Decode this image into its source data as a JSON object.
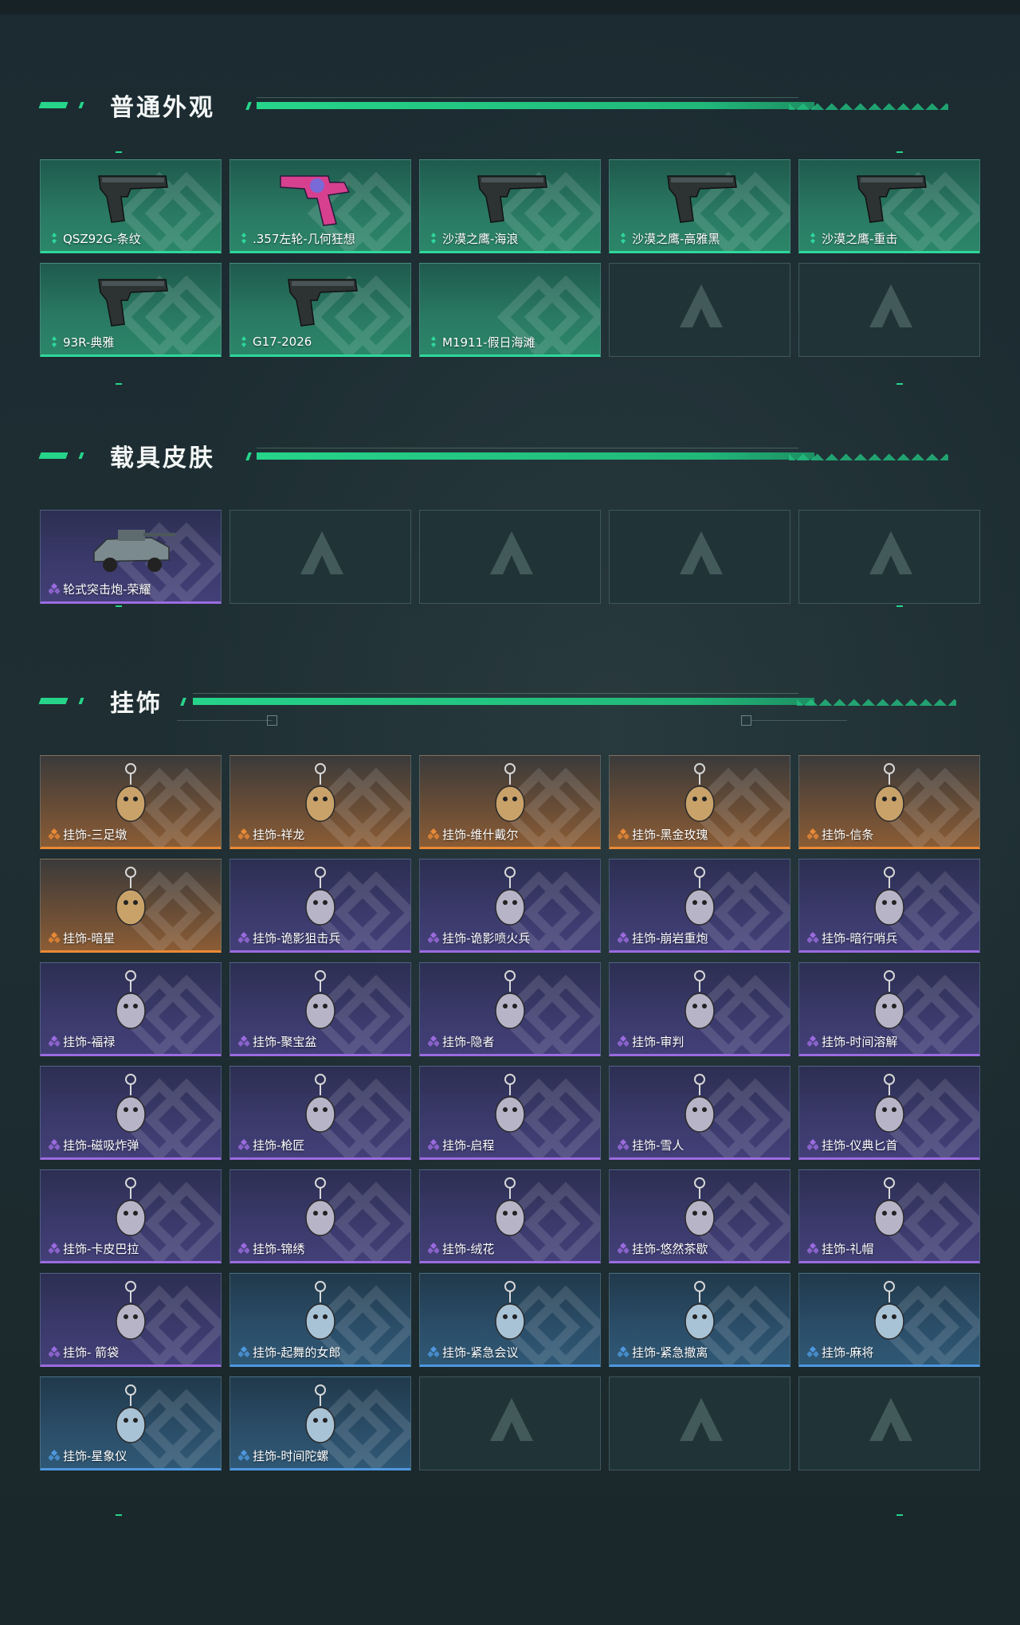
{
  "colors": {
    "accent": "#26d48a",
    "rarity_green": "#2fd79b",
    "rarity_purple": "#9b6be0",
    "rarity_orange": "#ea8a36",
    "rarity_blue": "#4e98df"
  },
  "sections": {
    "normal": {
      "title": "普通外观",
      "items": [
        {
          "name": "QSZ92G-条纹",
          "rarity": "green",
          "icon": "pistol-icon"
        },
        {
          "name": ".357左轮-几何狂想",
          "rarity": "green",
          "icon": "revolver-icon"
        },
        {
          "name": "沙漠之鹰-海浪",
          "rarity": "green",
          "icon": "pistol-icon"
        },
        {
          "name": "沙漠之鹰-高雅黑",
          "rarity": "green",
          "icon": "pistol-icon"
        },
        {
          "name": "沙漠之鹰-重击",
          "rarity": "green",
          "icon": "pistol-icon"
        },
        {
          "name": "93R-典雅",
          "rarity": "green",
          "icon": "pistol-icon"
        },
        {
          "name": "G17-2026",
          "rarity": "green",
          "icon": "pistol-icon"
        },
        {
          "name": "M1911-假日海滩",
          "rarity": "green",
          "icon": ""
        }
      ]
    },
    "vehicle": {
      "title": "载具皮肤",
      "items": [
        {
          "name": "轮式突击炮-荣耀",
          "rarity": "purple",
          "icon": "vehicle-icon"
        }
      ]
    },
    "charms": {
      "title": "挂饰",
      "items": [
        {
          "name": "挂饰-三足墩",
          "rarity": "orange",
          "icon": "charm-icon"
        },
        {
          "name": "挂饰-祥龙",
          "rarity": "orange",
          "icon": "charm-icon"
        },
        {
          "name": "挂饰-维什戴尔",
          "rarity": "orange",
          "icon": "charm-icon"
        },
        {
          "name": "挂饰-黑金玫瑰",
          "rarity": "orange",
          "icon": "charm-icon"
        },
        {
          "name": "挂饰-信条",
          "rarity": "orange",
          "icon": "charm-icon"
        },
        {
          "name": "挂饰-暗星",
          "rarity": "orange",
          "icon": "charm-icon"
        },
        {
          "name": "挂饰-诡影狙击兵",
          "rarity": "purple",
          "icon": "charm-icon"
        },
        {
          "name": "挂饰-诡影喷火兵",
          "rarity": "purple",
          "icon": "charm-icon"
        },
        {
          "name": "挂饰-崩岩重炮",
          "rarity": "purple",
          "icon": "charm-icon"
        },
        {
          "name": "挂饰-暗行哨兵",
          "rarity": "purple",
          "icon": "charm-icon"
        },
        {
          "name": "挂饰-福禄",
          "rarity": "purple",
          "icon": "charm-icon"
        },
        {
          "name": "挂饰-聚宝盆",
          "rarity": "purple",
          "icon": "charm-icon"
        },
        {
          "name": "挂饰-隐者",
          "rarity": "purple",
          "icon": "charm-icon"
        },
        {
          "name": "挂饰-审判",
          "rarity": "purple",
          "icon": "charm-icon"
        },
        {
          "name": "挂饰-时间溶解",
          "rarity": "purple",
          "icon": "charm-icon"
        },
        {
          "name": "挂饰-磁吸炸弹",
          "rarity": "purple",
          "icon": "charm-icon"
        },
        {
          "name": "挂饰-枪匠",
          "rarity": "purple",
          "icon": "charm-icon"
        },
        {
          "name": "挂饰-启程",
          "rarity": "purple",
          "icon": "charm-icon"
        },
        {
          "name": "挂饰-雪人",
          "rarity": "purple",
          "icon": "charm-icon"
        },
        {
          "name": "挂饰-仪典匕首",
          "rarity": "purple",
          "icon": "charm-icon"
        },
        {
          "name": "挂饰-卡皮巴拉",
          "rarity": "purple",
          "icon": "charm-icon"
        },
        {
          "name": "挂饰-锦绣",
          "rarity": "purple",
          "icon": "charm-icon"
        },
        {
          "name": "挂饰-绒花",
          "rarity": "purple",
          "icon": "charm-icon"
        },
        {
          "name": "挂饰-悠然茶歇",
          "rarity": "purple",
          "icon": "charm-icon"
        },
        {
          "name": "挂饰-礼帽",
          "rarity": "purple",
          "icon": "charm-icon"
        },
        {
          "name": "挂饰- 箭袋",
          "rarity": "purple",
          "icon": "charm-icon"
        },
        {
          "name": "挂饰-起舞的女郎",
          "rarity": "blue",
          "icon": "charm-icon"
        },
        {
          "name": "挂饰-紧急会议",
          "rarity": "blue",
          "icon": "charm-icon"
        },
        {
          "name": "挂饰-紧急撤离",
          "rarity": "blue",
          "icon": "charm-icon"
        },
        {
          "name": "挂饰-麻将",
          "rarity": "blue",
          "icon": "charm-icon"
        },
        {
          "name": "挂饰-星象仪",
          "rarity": "blue",
          "icon": "charm-icon"
        },
        {
          "name": "挂饰-时间陀螺",
          "rarity": "blue",
          "icon": "charm-icon"
        }
      ]
    }
  }
}
